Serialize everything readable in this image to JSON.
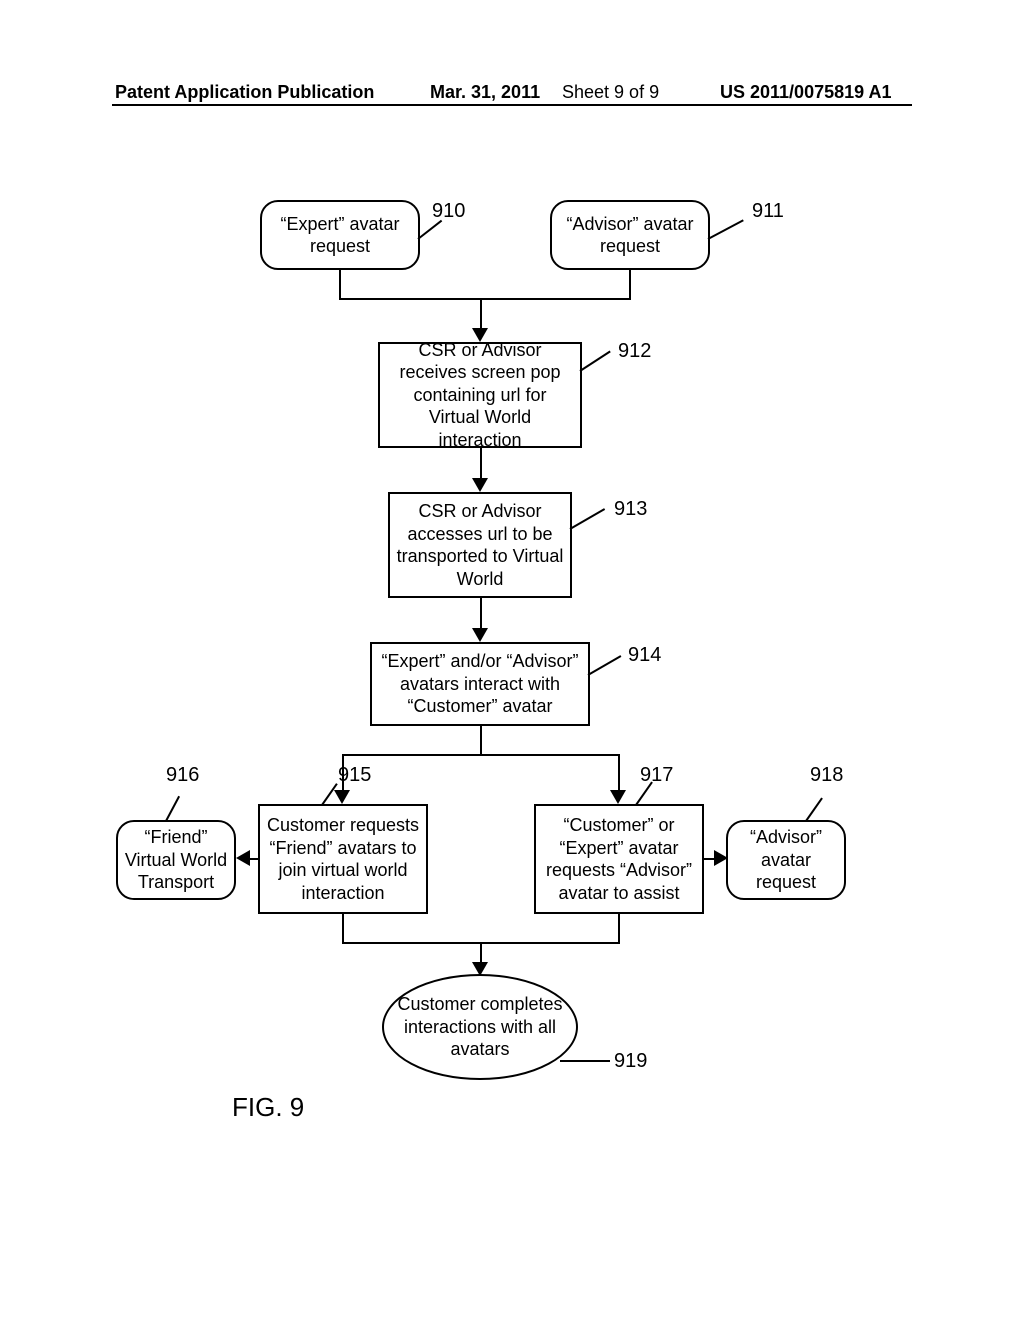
{
  "header": {
    "publication": "Patent Application Publication",
    "date": "Mar. 31, 2011",
    "sheet": "Sheet 9 of 9",
    "docnum": "US 2011/0075819 A1"
  },
  "figure_label": "FIG. 9",
  "nodes": {
    "n910": {
      "ref": "910",
      "text": "“Expert” avatar request"
    },
    "n911": {
      "ref": "911",
      "text": "“Advisor” avatar request"
    },
    "n912": {
      "ref": "912",
      "text": "CSR or Advisor receives screen pop containing url for Virtual World interaction"
    },
    "n913": {
      "ref": "913",
      "text": "CSR or Advisor accesses url to be transported to Virtual World"
    },
    "n914": {
      "ref": "914",
      "text": "“Expert” and/or “Advisor” avatars interact with “Customer” avatar"
    },
    "n915": {
      "ref": "915",
      "text": "Customer requests “Friend” avatars to join virtual world interaction"
    },
    "n916": {
      "ref": "916",
      "text": "“Friend” Virtual World Transport"
    },
    "n917": {
      "ref": "917",
      "text": "“Customer” or “Expert” avatar requests “Advisor” avatar to assist"
    },
    "n918": {
      "ref": "918",
      "text": "“Advisor” avatar request"
    },
    "n919": {
      "ref": "919",
      "text": "Customer completes interactions with all avatars"
    }
  }
}
